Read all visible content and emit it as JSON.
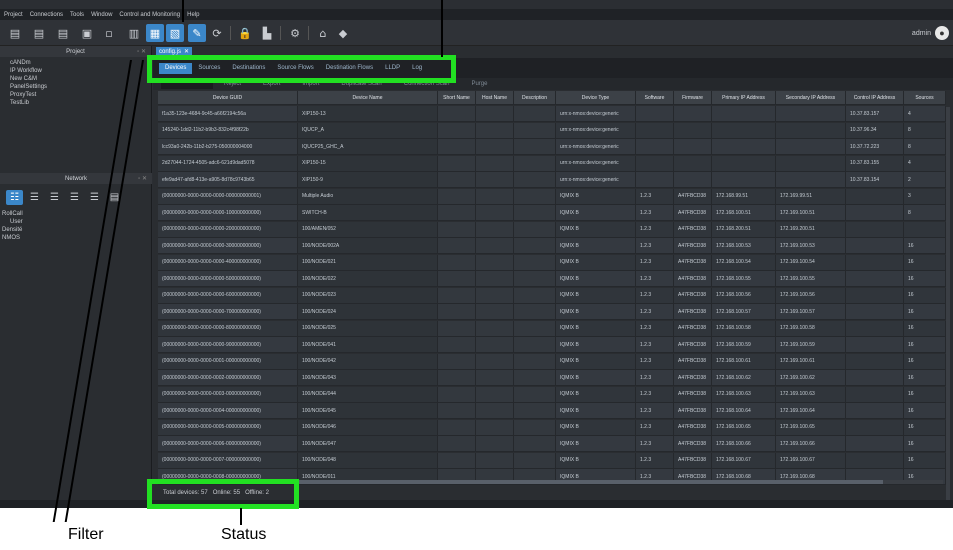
{
  "menu": [
    "Project",
    "Connections",
    "Tools",
    "Window",
    "Control and Monitoring",
    "Help"
  ],
  "user": {
    "name": "admin"
  },
  "left_panel": {
    "project_title": "Project",
    "project_items": [
      "cANDm",
      "IP Workflow",
      "New C&M",
      "PanelSettings",
      "ProxyTest",
      "TestLib"
    ],
    "network_title": "Network",
    "network_items": [
      "RollCall",
      "User",
      "Densité",
      "NMOS"
    ]
  },
  "doc_tab": "config.js",
  "tabs": [
    "Devices",
    "Sources",
    "Destinations",
    "Source Flows",
    "Destination Flows",
    "LLDP",
    "Log"
  ],
  "actions": [
    "",
    "Reject",
    "Export",
    "Import",
    "Duplicate Scan",
    "Connection Scan",
    "Purge"
  ],
  "columns": [
    "Device GUID",
    "Device Name",
    "Short Name",
    "Host Name",
    "Description",
    "Device Type",
    "Software",
    "Firmware",
    "Primary IP Address",
    "Secondary IP Address",
    "Control IP Address",
    "Sources"
  ],
  "rows": [
    [
      "f1a35-123e-4684-9c45-a66f2194c56a",
      "XIP150-13",
      "",
      "",
      "",
      "urn:x-nmos:device:generic",
      "",
      "",
      "",
      "",
      "10.37.83.157",
      "4"
    ],
    [
      "145240-1dd2-11b2-b9b3-832c4f98f22b",
      "IQUCP_A",
      "",
      "",
      "",
      "urn:x-nmos:device:generic",
      "",
      "",
      "",
      "",
      "10.37.96.34",
      "8"
    ],
    [
      "lcc93a0-242b-11b2-b275-050000004000",
      "IQUCP25_GHC_A",
      "",
      "",
      "",
      "urn:x-nmos:device:generic",
      "",
      "",
      "",
      "",
      "10.37.72.223",
      "8"
    ],
    [
      "2d27044-1724-4505-adc6-621d9dad5078",
      "XIP150-15",
      "",
      "",
      "",
      "urn:x-nmos:device:generic",
      "",
      "",
      "",
      "",
      "10.37.83.155",
      "4"
    ],
    [
      "efe9ad47-afd8-413e-a905-8d78c9743b65",
      "XIP150-9",
      "",
      "",
      "",
      "urn:x-nmos:device:generic",
      "",
      "",
      "",
      "",
      "10.37.83.154",
      "2"
    ],
    [
      "(00000000-0000-0000-0000-000000000001)",
      "Multiple Audio",
      "",
      "",
      "",
      "IQMIX B",
      "1.2.3",
      "A47FBCD38",
      "172.168.99.51",
      "172.169.99.51",
      "",
      "3"
    ],
    [
      "(00000000-0000-0000-0000-100000000000)",
      "SWITCH-B",
      "",
      "",
      "",
      "IQMIX B",
      "1.2.3",
      "A47FBCD38",
      "172.168.100.51",
      "172.169.100.51",
      "",
      "8"
    ],
    [
      "(00000000-0000-0000-0000-200000000000)",
      "100/AMEN/052",
      "",
      "",
      "",
      "IQMIX B",
      "1.2.3",
      "A47FBCD38",
      "172.168.200.51",
      "172.169.200.51",
      "",
      ""
    ],
    [
      "(00000000-0000-0000-0000-300000000000)",
      "100/NODE/002A",
      "",
      "",
      "",
      "IQMIX B",
      "1.2.3",
      "A47FBCD38",
      "172.168.100.53",
      "172.169.100.53",
      "",
      "16"
    ],
    [
      "(00000000-0000-0000-0000-400000000000)",
      "100/NODE/021",
      "",
      "",
      "",
      "IQMIX B",
      "1.2.3",
      "A47FBCD38",
      "172.168.100.54",
      "172.169.100.54",
      "",
      "16"
    ],
    [
      "(00000000-0000-0000-0000-500000000000)",
      "100/NODE/022",
      "",
      "",
      "",
      "IQMIX B",
      "1.2.3",
      "A47FBCD38",
      "172.168.100.55",
      "172.169.100.55",
      "",
      "16"
    ],
    [
      "(00000000-0000-0000-0000-600000000000)",
      "100/NODE/023",
      "",
      "",
      "",
      "IQMIX B",
      "1.2.3",
      "A47FBCD38",
      "172.168.100.56",
      "172.169.100.56",
      "",
      "16"
    ],
    [
      "(00000000-0000-0000-0000-700000000000)",
      "100/NODE/024",
      "",
      "",
      "",
      "IQMIX B",
      "1.2.3",
      "A47FBCD38",
      "172.168.100.57",
      "172.169.100.57",
      "",
      "16"
    ],
    [
      "(00000000-0000-0000-0000-800000000000)",
      "100/NODE/025",
      "",
      "",
      "",
      "IQMIX B",
      "1.2.3",
      "A47FBCD38",
      "172.168.100.58",
      "172.169.100.58",
      "",
      "16"
    ],
    [
      "(00000000-0000-0000-0000-900000000000)",
      "100/NODE/041",
      "",
      "",
      "",
      "IQMIX B",
      "1.2.3",
      "A47FBCD38",
      "172.168.100.59",
      "172.169.100.59",
      "",
      "16"
    ],
    [
      "(00000000-0000-0000-0001-000000000000)",
      "100/NODE/042",
      "",
      "",
      "",
      "IQMIX B",
      "1.2.3",
      "A47FBCD38",
      "172.168.100.61",
      "172.169.100.61",
      "",
      "16"
    ],
    [
      "(00000000-0000-0000-0002-000000000000)",
      "100/NODE/043",
      "",
      "",
      "",
      "IQMIX B",
      "1.2.3",
      "A47FBCD38",
      "172.168.100.62",
      "172.169.100.62",
      "",
      "16"
    ],
    [
      "(00000000-0000-0000-0003-000000000000)",
      "100/NODE/044",
      "",
      "",
      "",
      "IQMIX B",
      "1.2.3",
      "A47FBCD38",
      "172.168.100.63",
      "172.169.100.63",
      "",
      "16"
    ],
    [
      "(00000000-0000-0000-0004-000000000000)",
      "100/NODE/045",
      "",
      "",
      "",
      "IQMIX B",
      "1.2.3",
      "A47FBCD38",
      "172.168.100.64",
      "172.169.100.64",
      "",
      "16"
    ],
    [
      "(00000000-0000-0000-0005-000000000000)",
      "100/NODE/046",
      "",
      "",
      "",
      "IQMIX B",
      "1.2.3",
      "A47FBCD38",
      "172.168.100.65",
      "172.169.100.65",
      "",
      "16"
    ],
    [
      "(00000000-0000-0000-0006-000000000000)",
      "100/NODE/047",
      "",
      "",
      "",
      "IQMIX B",
      "1.2.3",
      "A47FBCD38",
      "172.168.100.66",
      "172.169.100.66",
      "",
      "16"
    ],
    [
      "(00000000-0000-0000-0007-000000000000)",
      "100/NODE/048",
      "",
      "",
      "",
      "IQMIX B",
      "1.2.3",
      "A47FBCD38",
      "172.168.100.67",
      "172.169.100.67",
      "",
      "16"
    ],
    [
      "(00000000-0000-0000-0008-000000000000)",
      "100/NODE/011",
      "",
      "",
      "",
      "IQMIX B",
      "1.2.3",
      "A47FBCD38",
      "172.168.100.68",
      "172.169.100.68",
      "",
      "16"
    ]
  ],
  "status": {
    "total": "Total devices: 57",
    "online": "Online: 55",
    "offline": "Offline: 2"
  },
  "callouts": {
    "filter": "Filter",
    "status": "Status"
  },
  "colors": {
    "accent": "#3b87c9",
    "highlight": "#22e022"
  }
}
